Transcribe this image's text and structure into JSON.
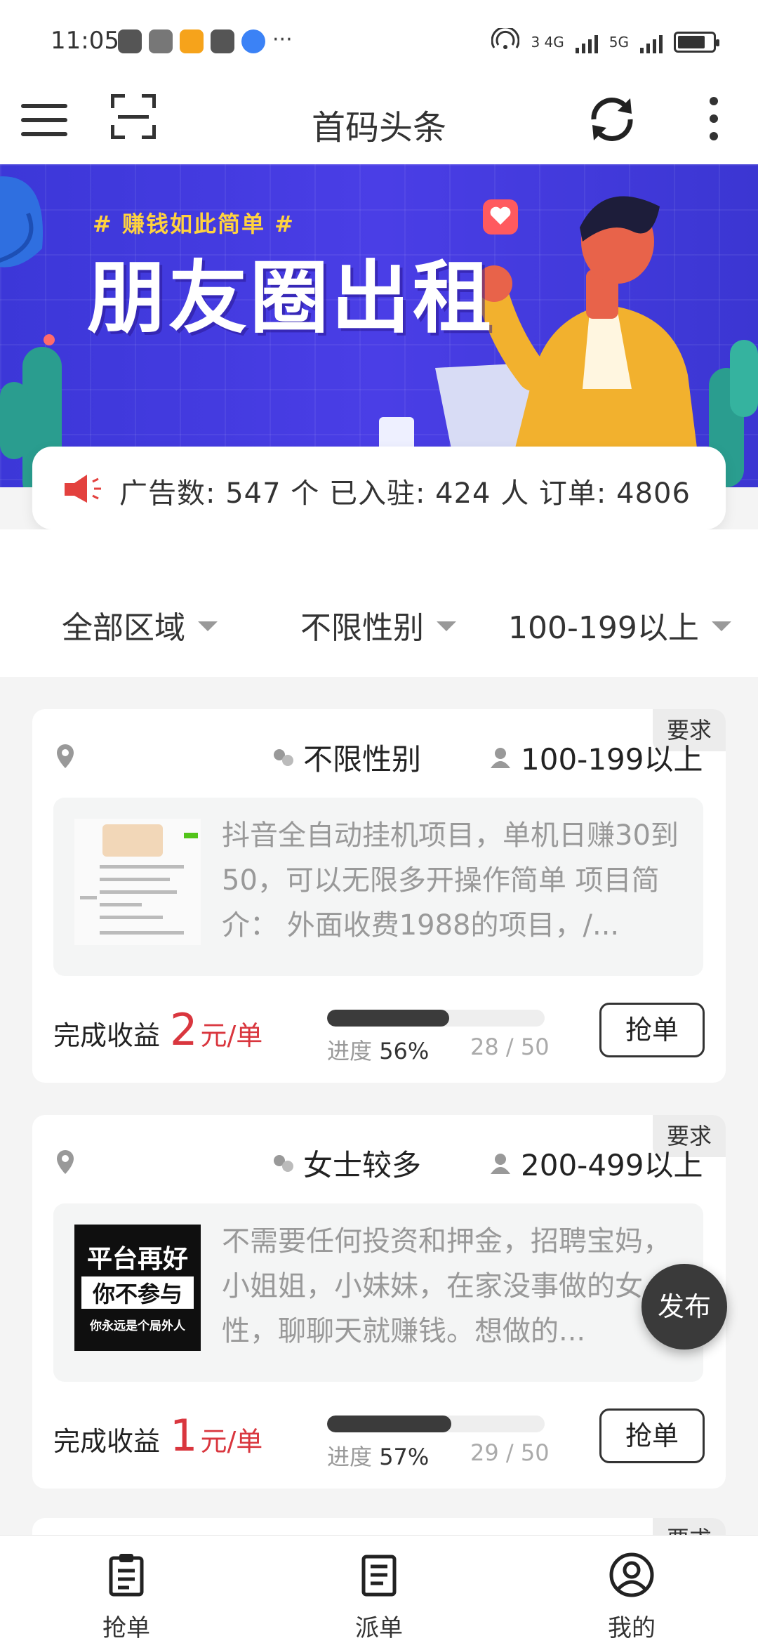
{
  "status_bar": {
    "time": "11:05",
    "network_labels": [
      "3 4G",
      "5G"
    ],
    "overflow": "···"
  },
  "app_bar": {
    "title": "首码头条"
  },
  "banner": {
    "tagline": "# 赚钱如此简单 #",
    "headline": "朋友圈出租"
  },
  "stats": {
    "text": "广告数: 547 个  已入驻: 424 人  订单: 4806"
  },
  "filters": [
    {
      "label": "全部区域"
    },
    {
      "label": "不限性别"
    },
    {
      "label": "100-199以上"
    }
  ],
  "cards": [
    {
      "tag": "要求",
      "gender": "不限性别",
      "age": "100-199以上",
      "description": "抖音全自动挂机项目，单机日赚30到50，可以无限多开操作简单 项目简介： 外面收费1988的项目，/...",
      "earn_label": "完成收益",
      "earn_value": "2",
      "earn_unit": "元/单",
      "progress_label": "进度",
      "progress_percent": "56%",
      "progress_fraction": 0.56,
      "progress_count": "28 / 50",
      "grab_label": "抢单"
    },
    {
      "tag": "要求",
      "gender": "女士较多",
      "age": "200-499以上",
      "description": "不需要任何投资和押金，招聘宝妈，小姐姐，小妹妹，在家没事做的女性，聊聊天就赚钱。想做的...",
      "thumb_text": [
        "平台再好",
        "你不参与",
        "你永远是个局外人"
      ],
      "earn_label": "完成收益",
      "earn_value": "1",
      "earn_unit": "元/单",
      "progress_label": "进度",
      "progress_percent": "57%",
      "progress_fraction": 0.57,
      "progress_count": "29 / 50",
      "grab_label": "抢单"
    }
  ],
  "fab": {
    "label": "发布"
  },
  "bottom_nav": [
    {
      "label": "抢单",
      "icon": "clipboard-icon"
    },
    {
      "label": "派单",
      "icon": "document-list-icon"
    },
    {
      "label": "我的",
      "icon": "user-circle-icon"
    }
  ],
  "colors": {
    "accent_red": "#d9363e",
    "banner_blue": "#4a3ee6",
    "banner_yellow": "#ffd23f"
  }
}
